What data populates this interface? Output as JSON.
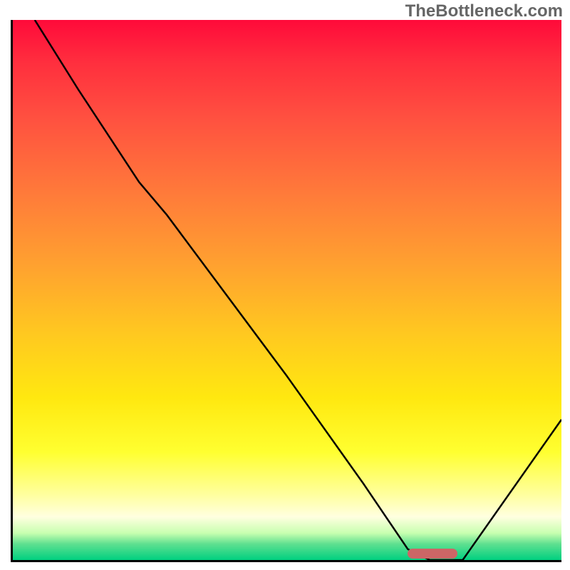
{
  "watermark": "TheBottleneck.com",
  "chart_data": {
    "type": "line",
    "title": "",
    "xlabel": "",
    "ylabel": "",
    "xlim": [
      0,
      100
    ],
    "ylim": [
      0,
      100
    ],
    "grid": false,
    "series": [
      {
        "name": "curve",
        "x": [
          4,
          12,
          23,
          28,
          50,
          64,
          72,
          76,
          82,
          100
        ],
        "values": [
          100,
          87,
          70,
          64,
          34,
          14,
          2,
          0,
          0,
          26
        ]
      }
    ],
    "marker": {
      "x_start": 72,
      "x_end": 81,
      "y": 1.2,
      "color": "#cc6666"
    },
    "gradient_stops": [
      {
        "pct": 0,
        "color": "#ff0a3a"
      },
      {
        "pct": 18,
        "color": "#ff5040"
      },
      {
        "pct": 45,
        "color": "#ffa030"
      },
      {
        "pct": 70,
        "color": "#ffe810"
      },
      {
        "pct": 88,
        "color": "#ffffa0"
      },
      {
        "pct": 97,
        "color": "#60e090"
      },
      {
        "pct": 100,
        "color": "#00d080"
      }
    ]
  }
}
